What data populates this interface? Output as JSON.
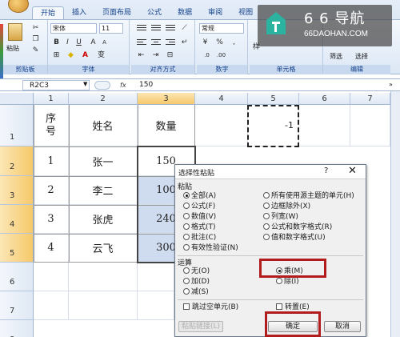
{
  "ribbon": {
    "tabs": [
      "开始",
      "插入",
      "页面布局",
      "公式",
      "数据",
      "审阅",
      "视图"
    ],
    "active_tab": "开始",
    "clipboard": {
      "paste_label": "粘贴",
      "group_label": "剪贴板"
    },
    "font": {
      "font_name": "宋体",
      "font_size": "11",
      "bold": "B",
      "italic": "I",
      "underline": "U",
      "font_color_glyph": "A",
      "phonetic_glyph": "变",
      "group_label": "字体"
    },
    "alignment": {
      "group_label": "对齐方式"
    },
    "number": {
      "format": "常规",
      "percent": "%",
      "comma": ",",
      "group_label": "数字"
    },
    "cells": {
      "style_label": "样",
      "group_label": "单元格"
    },
    "editing": {
      "filter_label": "筛选",
      "select_label": "选择",
      "group_label": "编辑"
    }
  },
  "watermark": {
    "title": "6 6 导航",
    "subtitle": "66DAOHAN.COM"
  },
  "formula_bar": {
    "name_box": "R2C3",
    "fx": "fx",
    "value": "150"
  },
  "grid": {
    "columns": [
      "1",
      "2",
      "3",
      "4",
      "5",
      "6",
      "7"
    ],
    "rows": [
      "1",
      "2",
      "3",
      "4",
      "5",
      "6",
      "7",
      "8"
    ],
    "header_row": {
      "col1": "序\n号",
      "col2": "姓名",
      "col3": "数量"
    },
    "data": [
      {
        "seq": "1",
        "name": "张一",
        "qty": "150"
      },
      {
        "seq": "2",
        "name": "李二",
        "qty": "100"
      },
      {
        "seq": "3",
        "name": "张虎",
        "qty": "240"
      },
      {
        "seq": "4",
        "name": "云飞",
        "qty": "300"
      }
    ],
    "copied_value": "-1"
  },
  "dialog": {
    "title": "选择性粘贴",
    "help": "?",
    "close": "✕",
    "paste_section": "粘贴",
    "paste_options_left": [
      "全部(A)",
      "公式(F)",
      "数值(V)",
      "格式(T)",
      "批注(C)",
      "有效性验证(N)"
    ],
    "paste_options_right": [
      "所有使用源主题的单元(H)",
      "边框除外(X)",
      "列宽(W)",
      "公式和数字格式(R)",
      "值和数字格式(U)"
    ],
    "selected_paste": "全部(A)",
    "operation_section": "运算",
    "operation_left": [
      "无(O)",
      "加(D)",
      "减(S)"
    ],
    "operation_right": [
      "乘(M)",
      "除(I)"
    ],
    "selected_operation": "乘(M)",
    "skip_blanks": "跳过空单元(B)",
    "transpose": "转置(E)",
    "paste_link_button": "粘贴链接(L)",
    "ok_button": "确定",
    "cancel_button": "取消"
  },
  "colors": {
    "highlight_red": "#b11c1c",
    "selection_orange": "#f6c96a"
  }
}
